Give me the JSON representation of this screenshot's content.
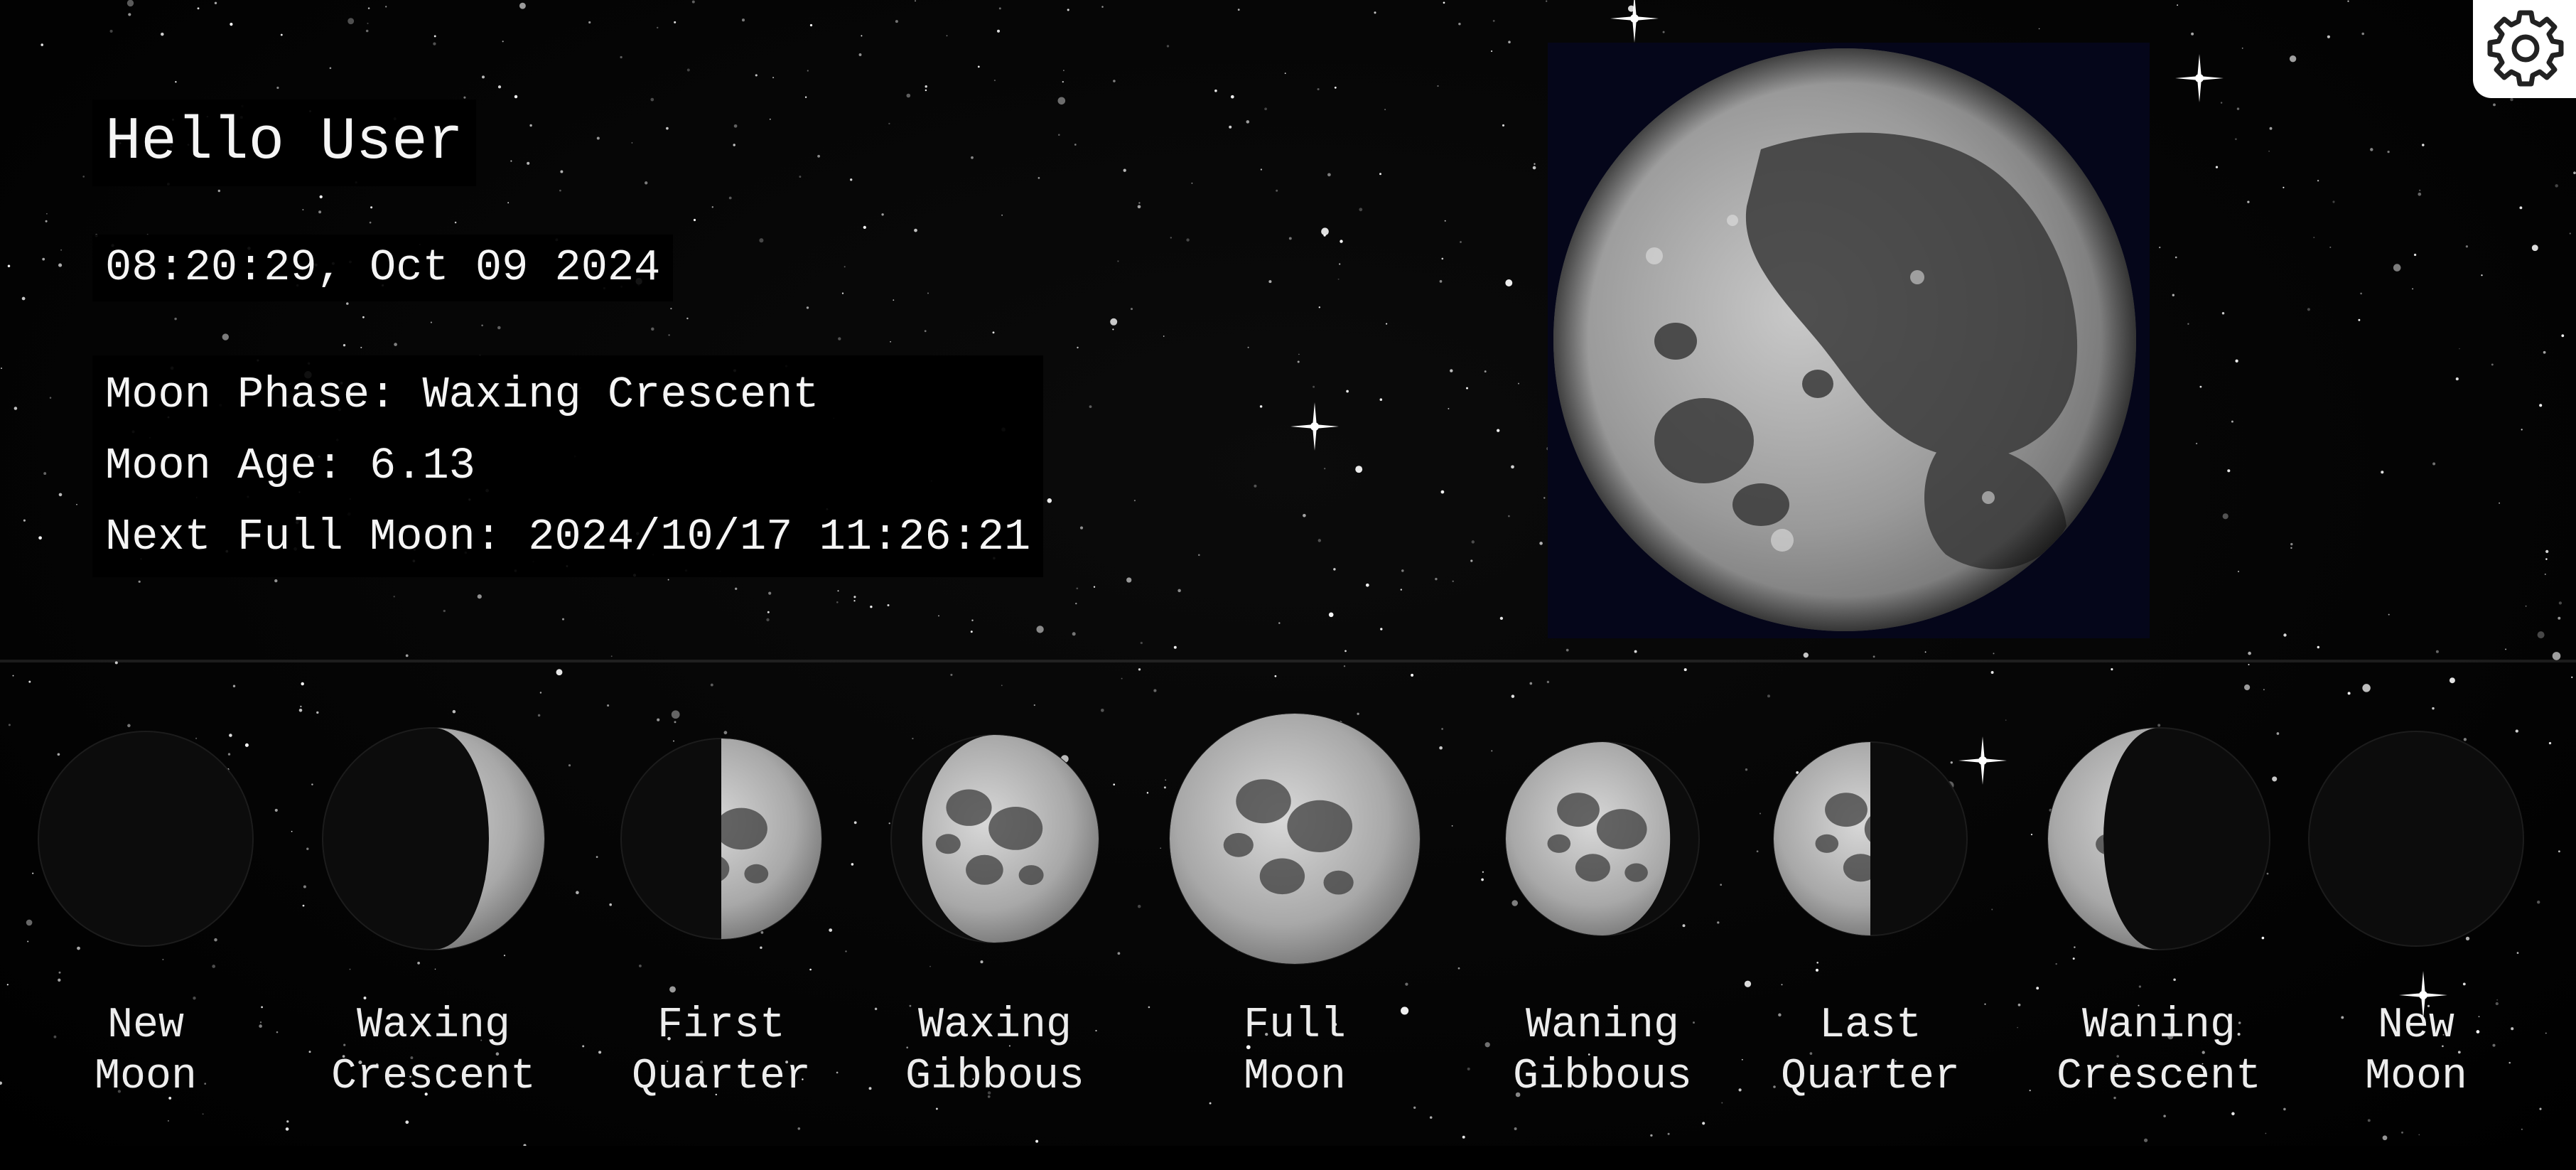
{
  "header": {
    "greeting": "Hello User",
    "datetime": "08:20:29, Oct 09 2024"
  },
  "moon_info": {
    "phase_label": "Moon Phase: Waxing Crescent",
    "age_label": "Moon Age: 6.13",
    "next_full_label": "Next Full Moon: 2024/10/17 11:26:21"
  },
  "settings": {
    "icon": "gear-icon"
  },
  "colors": {
    "background": "#000000",
    "moon_frame_background": "#05061a",
    "text": "#f2f2f2",
    "settings_button": "#ffffff"
  },
  "phases": [
    {
      "label": "New\nMoon",
      "icon": "new-moon-icon",
      "illumination": 0.0
    },
    {
      "label": "Waxing\nCrescent",
      "icon": "waxing-crescent-icon",
      "illumination": 0.25
    },
    {
      "label": "First\nQuarter",
      "icon": "first-quarter-icon",
      "illumination": 0.5
    },
    {
      "label": "Waxing\nGibbous",
      "icon": "waxing-gibbous-icon",
      "illumination": 0.85
    },
    {
      "label": "Full\nMoon",
      "icon": "full-moon-icon",
      "illumination": 1.0
    },
    {
      "label": "Waning\nGibbous",
      "icon": "waning-gibbous-icon",
      "illumination": 0.85
    },
    {
      "label": "Last\nQuarter",
      "icon": "last-quarter-icon",
      "illumination": 0.5
    },
    {
      "label": "Waning\nCrescent",
      "icon": "waning-crescent-icon",
      "illumination": 0.25
    },
    {
      "label": "New\nMoon",
      "icon": "new-moon-icon",
      "illumination": 0.0
    }
  ]
}
